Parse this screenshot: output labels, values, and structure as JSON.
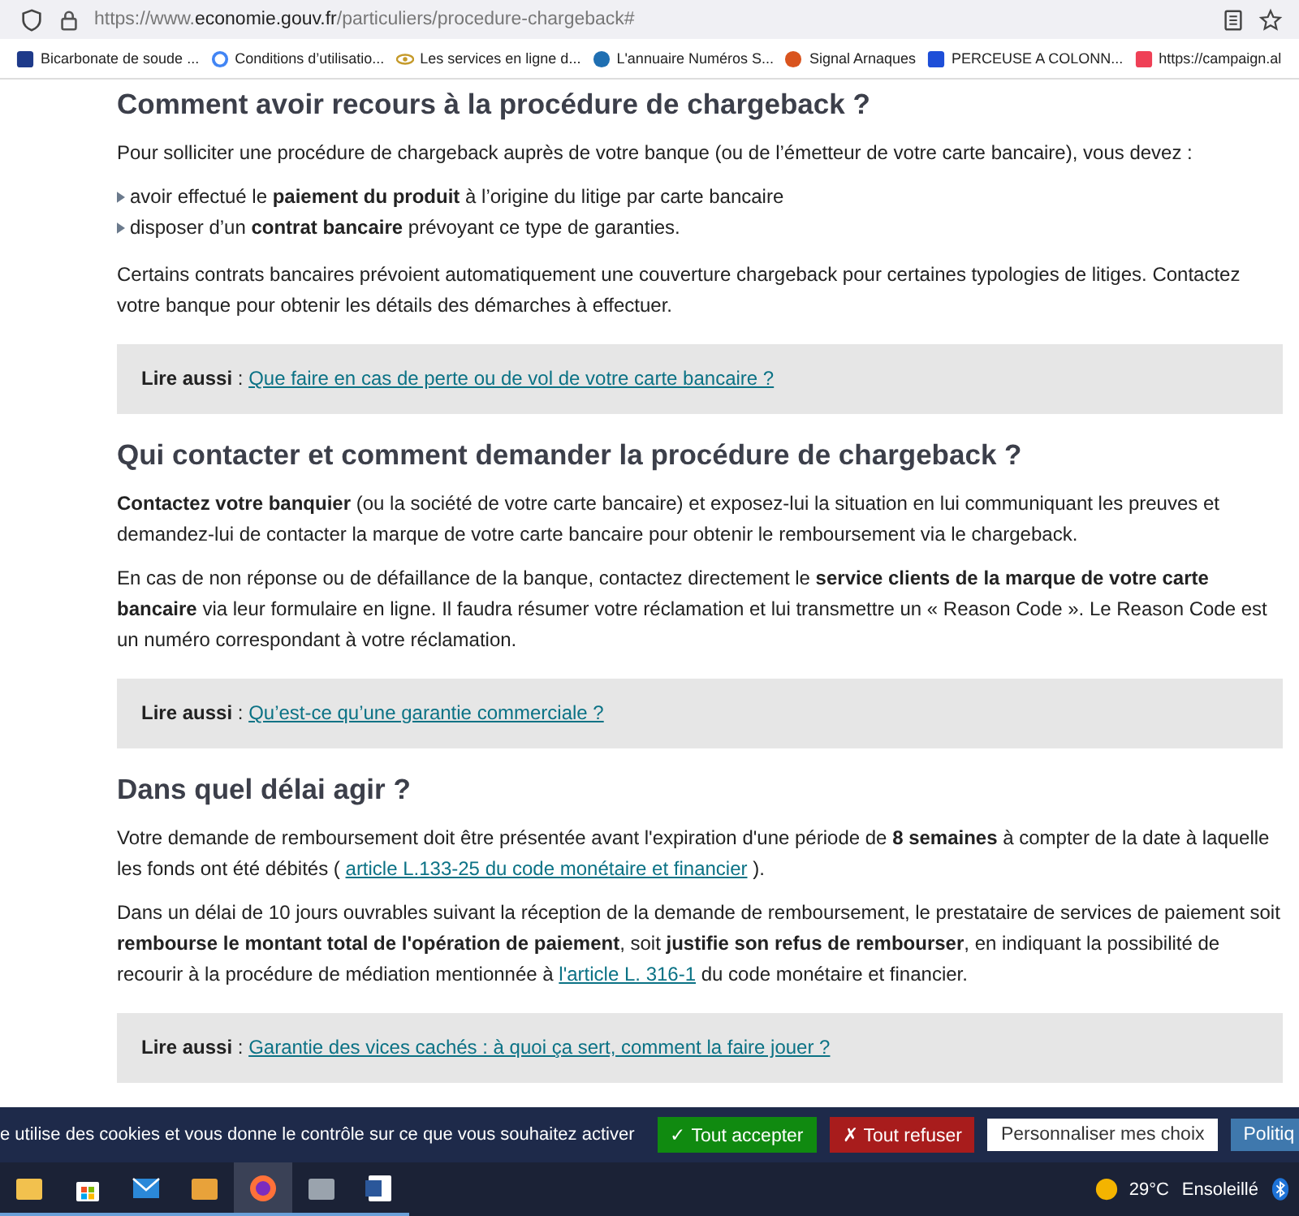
{
  "address_bar": {
    "url_prefix": "https://www.",
    "url_domain": "economie.gouv.fr",
    "url_path": "/particuliers/procedure-chargeback#"
  },
  "bookmarks": [
    {
      "label": "Bicarbonate de soude ..."
    },
    {
      "label": "Conditions d’utilisatio..."
    },
    {
      "label": "Les services en ligne d..."
    },
    {
      "label": "L'annuaire Numéros S..."
    },
    {
      "label": "Signal Arnaques"
    },
    {
      "label": "PERCEUSE A COLONN..."
    },
    {
      "label": "https://campaign.al"
    }
  ],
  "sections": [
    {
      "heading": "Comment avoir recours à la procédure de chargeback ?",
      "blocks": [
        {
          "kind": "paragraph",
          "parts": [
            {
              "kind": "text",
              "text": "Pour solliciter une procédure de chargeback auprès de votre banque (ou de l’émetteur de votre carte bancaire), vous devez :"
            }
          ]
        },
        {
          "kind": "list",
          "items": [
            "avoir effectué le **paiement du produit** à l’origine du litige par carte bancaire",
            "disposer d’un **contrat bancaire** prévoyant ce type de garanties."
          ]
        },
        {
          "kind": "paragraph",
          "parts": [
            {
              "kind": "text",
              "text": "Certains contrats bancaires prévoient automatiquement une couverture chargeback pour certaines typologies de litiges. Contactez votre banque pour obtenir les détails des démarches à effectuer."
            }
          ]
        },
        {
          "kind": "see_also",
          "label": "Lire aussi",
          "separator": ":",
          "link": "Que faire en cas de perte ou de vol de votre carte bancaire ?"
        }
      ]
    },
    {
      "heading": "Qui contacter et comment demander la procédure de chargeback ?",
      "blocks": [
        {
          "kind": "paragraph",
          "parts": [
            {
              "kind": "text",
              "text": "**Contactez votre banquier** (ou la société de votre carte bancaire) et exposez-lui la situation en lui communiquant les preuves et demandez-lui de contacter la marque de votre carte bancaire pour obtenir le remboursement via le chargeback."
            }
          ]
        },
        {
          "kind": "paragraph",
          "parts": [
            {
              "kind": "text",
              "text": "En cas de non réponse ou de défaillance de la banque, contactez directement le **service clients de la marque de votre carte bancaire** via leur formulaire en ligne. Il faudra résumer votre réclamation et lui transmettre un « Reason Code ». Le Reason Code est un numéro correspondant à votre réclamation."
            }
          ]
        },
        {
          "kind": "see_also",
          "label": "Lire aussi",
          "separator": ":",
          "link": "Qu’est-ce qu’une garantie commerciale ?"
        }
      ]
    },
    {
      "heading": "Dans quel délai agir ?",
      "blocks": [
        {
          "kind": "paragraph",
          "parts": [
            {
              "kind": "text",
              "text": "Votre demande de remboursement doit être présentée avant l'expiration d'une période de **8 semaines** à compter de la date à laquelle les fonds ont été débités ("
            },
            {
              "kind": "link",
              "text": "article L.133-25 du code monétaire et financier"
            },
            {
              "kind": "text",
              "text": ")."
            }
          ]
        },
        {
          "kind": "paragraph",
          "parts": [
            {
              "kind": "text",
              "text": "Dans un délai de 10 jours ouvrables suivant la réception de la demande de remboursement, le prestataire de services de paiement soit **rembourse le montant total de l'opération de paiement**, soit **justifie son refus de rembourser**, en indiquant la possibilité de recourir à la procédure de médiation mentionnée à"
            },
            {
              "kind": "link",
              "text": "l'article L. 316-1"
            },
            {
              "kind": "text",
              "text": "du code monétaire et financier."
            }
          ]
        },
        {
          "kind": "see_also",
          "label": "Lire aussi",
          "separator": ":",
          "link": "Garantie des vices cachés : à quoi ça sert, comment la faire jouer ?"
        }
      ]
    }
  ],
  "cookie_bar": {
    "message": "e utilise des cookies et vous donne le contrôle sur ce que vous souhaitez activer",
    "buttons": [
      {
        "label": "✓ Tout accepter",
        "kind": "accept"
      },
      {
        "label": "✗ Tout refuser",
        "kind": "refuse"
      },
      {
        "label": "Personnaliser mes choix",
        "kind": "customize"
      },
      {
        "label": "Politiq",
        "kind": "policy"
      }
    ]
  },
  "taskbar": {
    "apps": [
      {
        "selected": false
      },
      {
        "selected": false
      },
      {
        "selected": false
      },
      {
        "selected": false
      },
      {
        "selected": true
      },
      {
        "selected": false
      },
      {
        "selected": false
      }
    ],
    "temperature": "29°C",
    "weather": "Ensoleillé"
  }
}
